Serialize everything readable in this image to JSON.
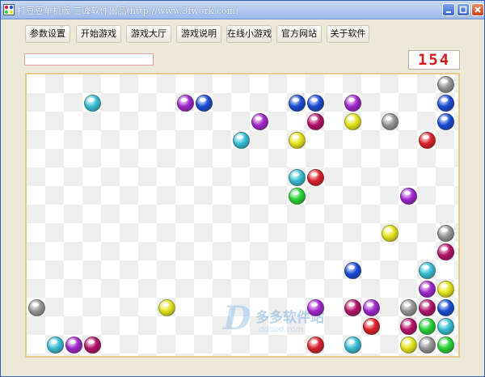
{
  "window": {
    "title": "打豆豆单机版 三峰软件出品(http://www.3fwork.com)"
  },
  "toolbar": {
    "buttons": [
      "参数设置",
      "开始游戏",
      "游戏大厅",
      "游戏说明",
      "在线小游戏",
      "官方网站",
      "关于软件"
    ]
  },
  "game": {
    "status_text": "",
    "score": "154",
    "board": {
      "cols": 23,
      "rows": 15,
      "balls": [
        {
          "col": 22,
          "row": 0,
          "color": "gray"
        },
        {
          "col": 3,
          "row": 1,
          "color": "cyan"
        },
        {
          "col": 8,
          "row": 1,
          "color": "purple"
        },
        {
          "col": 9,
          "row": 1,
          "color": "blue"
        },
        {
          "col": 14,
          "row": 1,
          "color": "blue"
        },
        {
          "col": 15,
          "row": 1,
          "color": "blue"
        },
        {
          "col": 17,
          "row": 1,
          "color": "purple"
        },
        {
          "col": 22,
          "row": 1,
          "color": "blue"
        },
        {
          "col": 12,
          "row": 2,
          "color": "purple"
        },
        {
          "col": 15,
          "row": 2,
          "color": "magenta"
        },
        {
          "col": 17,
          "row": 2,
          "color": "yellow"
        },
        {
          "col": 19,
          "row": 2,
          "color": "gray"
        },
        {
          "col": 22,
          "row": 2,
          "color": "blue"
        },
        {
          "col": 11,
          "row": 3,
          "color": "cyan"
        },
        {
          "col": 14,
          "row": 3,
          "color": "yellow"
        },
        {
          "col": 21,
          "row": 3,
          "color": "red"
        },
        {
          "col": 14,
          "row": 5,
          "color": "cyan"
        },
        {
          "col": 15,
          "row": 5,
          "color": "red"
        },
        {
          "col": 14,
          "row": 6,
          "color": "green"
        },
        {
          "col": 20,
          "row": 6,
          "color": "purple"
        },
        {
          "col": 19,
          "row": 8,
          "color": "yellow"
        },
        {
          "col": 22,
          "row": 8,
          "color": "gray"
        },
        {
          "col": 22,
          "row": 9,
          "color": "magenta"
        },
        {
          "col": 17,
          "row": 10,
          "color": "blue"
        },
        {
          "col": 21,
          "row": 10,
          "color": "cyan"
        },
        {
          "col": 21,
          "row": 11,
          "color": "purple"
        },
        {
          "col": 22,
          "row": 11,
          "color": "yellow"
        },
        {
          "col": 0,
          "row": 12,
          "color": "gray"
        },
        {
          "col": 7,
          "row": 12,
          "color": "yellow"
        },
        {
          "col": 15,
          "row": 12,
          "color": "purple"
        },
        {
          "col": 17,
          "row": 12,
          "color": "magenta"
        },
        {
          "col": 18,
          "row": 12,
          "color": "purple"
        },
        {
          "col": 20,
          "row": 12,
          "color": "gray"
        },
        {
          "col": 21,
          "row": 12,
          "color": "magenta"
        },
        {
          "col": 22,
          "row": 12,
          "color": "blue"
        },
        {
          "col": 18,
          "row": 13,
          "color": "red"
        },
        {
          "col": 20,
          "row": 13,
          "color": "magenta"
        },
        {
          "col": 21,
          "row": 13,
          "color": "green"
        },
        {
          "col": 22,
          "row": 13,
          "color": "cyan"
        },
        {
          "col": 1,
          "row": 14,
          "color": "cyan"
        },
        {
          "col": 2,
          "row": 14,
          "color": "purple"
        },
        {
          "col": 3,
          "row": 14,
          "color": "magenta"
        },
        {
          "col": 15,
          "row": 14,
          "color": "red"
        },
        {
          "col": 17,
          "row": 14,
          "color": "cyan"
        },
        {
          "col": 20,
          "row": 14,
          "color": "yellow"
        },
        {
          "col": 21,
          "row": 14,
          "color": "gray"
        },
        {
          "col": 22,
          "row": 14,
          "color": "green"
        }
      ]
    },
    "palette": {
      "gray": "#9a9a9a",
      "cyan": "#3cc3d8",
      "purple": "#a52ad0",
      "blue": "#1d4fd8",
      "magenta": "#b8146c",
      "yellow": "#eaea1e",
      "red": "#e02430",
      "green": "#2ad83a"
    },
    "watermark": {
      "logo": "D",
      "text": "多多软件站",
      "subtext": "ddooo.com"
    }
  }
}
